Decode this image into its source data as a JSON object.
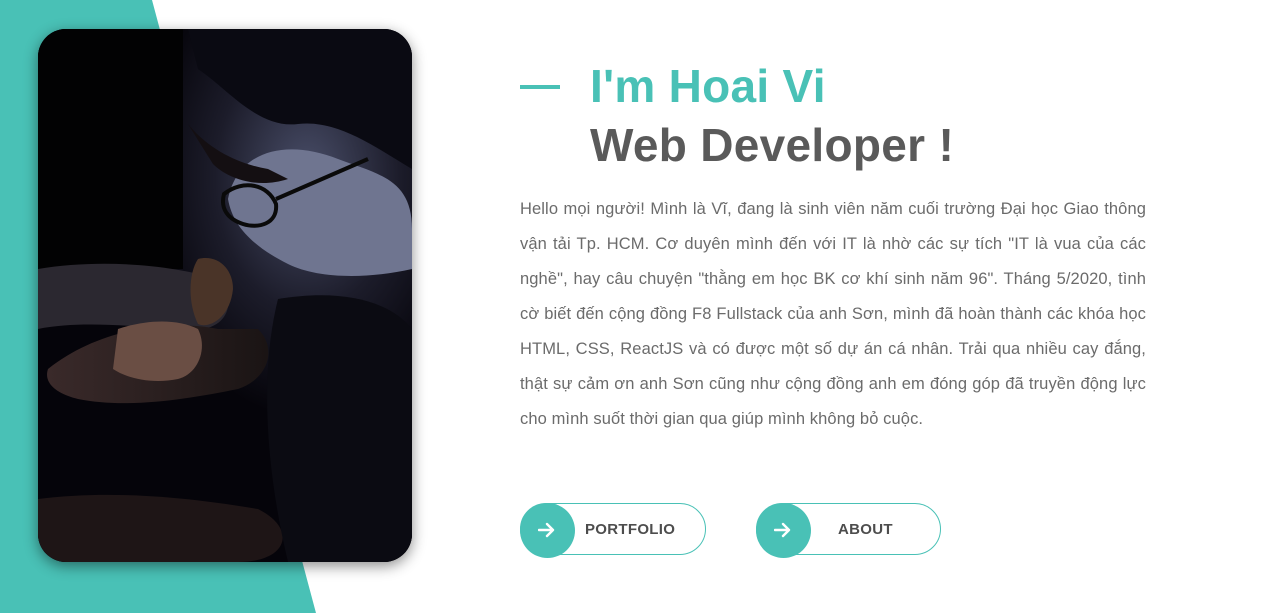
{
  "theme": {
    "accent": "#49c1b6",
    "heading_dark": "#5a5a5a",
    "body_text": "#6b6b6b"
  },
  "hero": {
    "name": "I'm Hoai Vi",
    "role": "Web Developer !",
    "intro": "Hello mọi người! Mình là Vĩ, đang là sinh viên năm cuối trường Đại học Giao thông vận tải Tp. HCM. Cơ duyên mình đến với IT là nhờ các sự tích \"IT là vua của các nghề\", hay câu chuyện \"thằng em học BK cơ khí sinh năm 96\". Tháng 5/2020, tình cờ biết đến cộng đồng F8 Fullstack của anh Sơn, mình đã hoàn thành các khóa học HTML, CSS, ReactJS và có được một số dự án cá nhân. Trải qua nhiều cay đắng, thật sự cảm ơn anh Sơn cũng như cộng đồng anh em đóng góp đã truyền động lực cho mình suốt thời gian qua giúp mình không bỏ cuộc."
  },
  "buttons": {
    "portfolio": {
      "label": "PORTFOLIO",
      "icon": "arrow-right-icon"
    },
    "about": {
      "label": "ABOUT",
      "icon": "arrow-right-icon"
    }
  }
}
